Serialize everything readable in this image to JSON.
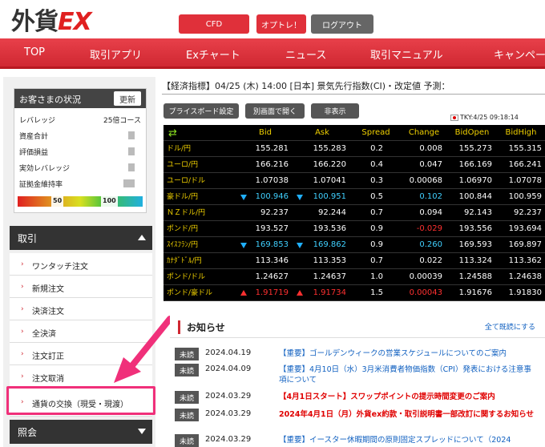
{
  "header": {
    "logo_main": "外貨",
    "logo_ex": "EX",
    "buttons": {
      "cfd": "CFD",
      "option": "オプトレ！",
      "logout": "ログアウト"
    }
  },
  "nav": [
    "TOP",
    "取引アプリ",
    "Exチャート",
    "ニュース",
    "取引マニュアル",
    "キャンペー"
  ],
  "status": {
    "title": "お客さまの状況",
    "update_label": "更新",
    "rows": [
      {
        "label": "レバレッジ",
        "value": "25倍コース"
      },
      {
        "label": "資産合計",
        "value": ""
      },
      {
        "label": "評価損益",
        "value": ""
      },
      {
        "label": "実効レバレッジ",
        "value": ""
      },
      {
        "label": "証拠金維持率",
        "value": ""
      }
    ],
    "gauge_labels": [
      "50",
      "100"
    ]
  },
  "sidebar": {
    "section_trade": "取引",
    "items": [
      "ワンタッチ注文",
      "新規注文",
      "決済注文",
      "全決済",
      "注文訂正",
      "注文取消",
      "通貨の交換（現受・現渡）"
    ],
    "section_inquiry": "照会"
  },
  "ticker": "【経済指標】04/25 (木) 14:00 [日本] 景気先行指数(CI)・改定値 予測：",
  "controls": {
    "board_settings": "プライスボード設定",
    "open_separate": "別画面で開く",
    "hide": "非表示"
  },
  "timestamp": "TKY:4/25 09:18:14",
  "board": {
    "columns": [
      "Bid",
      "Ask",
      "Spread",
      "Change",
      "BidOpen",
      "BidHigh"
    ],
    "rows": [
      {
        "pair": "ドル/円",
        "bid": "155.281",
        "ask": "155.283",
        "spread": "0.2",
        "change": "0.008",
        "open": "155.273",
        "high": "155.315",
        "dir": ""
      },
      {
        "pair": "ユーロ/円",
        "bid": "166.216",
        "ask": "166.220",
        "spread": "0.4",
        "change": "0.047",
        "open": "166.169",
        "high": "166.241",
        "dir": ""
      },
      {
        "pair": "ユーロ/ドル",
        "bid": "1.07038",
        "ask": "1.07041",
        "spread": "0.3",
        "change": "0.00068",
        "open": "1.06970",
        "high": "1.07078",
        "dir": ""
      },
      {
        "pair": "豪ドル/円",
        "bid": "100.946",
        "ask": "100.951",
        "spread": "0.5",
        "change": "0.102",
        "open": "100.844",
        "high": "100.959",
        "dir": "down"
      },
      {
        "pair": "ＮＺドル/円",
        "bid": "92.237",
        "ask": "92.244",
        "spread": "0.7",
        "change": "0.094",
        "open": "92.143",
        "high": "92.237",
        "dir": ""
      },
      {
        "pair": "ポンド/円",
        "bid": "193.527",
        "ask": "193.536",
        "spread": "0.9",
        "change": "-0.029",
        "open": "193.556",
        "high": "193.694",
        "dir": ""
      },
      {
        "pair": "ｽｲｽﾌﾗﾝ/円",
        "bid": "169.853",
        "ask": "169.862",
        "spread": "0.9",
        "change": "0.260",
        "open": "169.593",
        "high": "169.897",
        "dir": "down"
      },
      {
        "pair": "ｶﾅﾀﾞﾄﾞﾙ/円",
        "bid": "113.346",
        "ask": "113.353",
        "spread": "0.7",
        "change": "0.022",
        "open": "113.324",
        "high": "113.362",
        "dir": ""
      },
      {
        "pair": "ポンド/ドル",
        "bid": "1.24627",
        "ask": "1.24637",
        "spread": "1.0",
        "change": "0.00039",
        "open": "1.24588",
        "high": "1.24638",
        "dir": ""
      },
      {
        "pair": "ポンド/豪ドル",
        "bid": "1.91719",
        "ask": "1.91734",
        "spread": "1.5",
        "change": "0.00043",
        "open": "1.91676",
        "high": "1.91830",
        "dir": "up"
      }
    ]
  },
  "notices": {
    "title": "お知らせ",
    "mark_all_read": "全て既読にする",
    "items": [
      {
        "badge": "未読",
        "date": "2024.04.19",
        "text": "【重要】ゴールデンウィークの営業スケジュールについてのご案内",
        "red": false
      },
      {
        "badge": "未読",
        "date": "2024.04.09",
        "text": "【重要】4月10日（水）3月米消費者物価指数（CPI）発表における注意事項について",
        "red": false
      },
      {
        "badge": "未読",
        "date": "2024.03.29",
        "text": "【4月1日スタート】スワップポイントの提示時間変更のご案内",
        "red": true
      },
      {
        "badge": "未読",
        "date": "2024.03.29",
        "text": "2024年4月1日（月）外貨ex約款・取引説明書一部改訂に関するお知らせ",
        "red": true
      },
      {
        "badge": "未読",
        "date": "2024.03.29",
        "text": "【重要】イースター休暇期間の原則固定スプレッドについて（2024",
        "red": false
      }
    ]
  },
  "colors": {
    "brand_red": "#d02832",
    "highlight_pink": "#f0307a",
    "board_label": "#f0d000"
  }
}
